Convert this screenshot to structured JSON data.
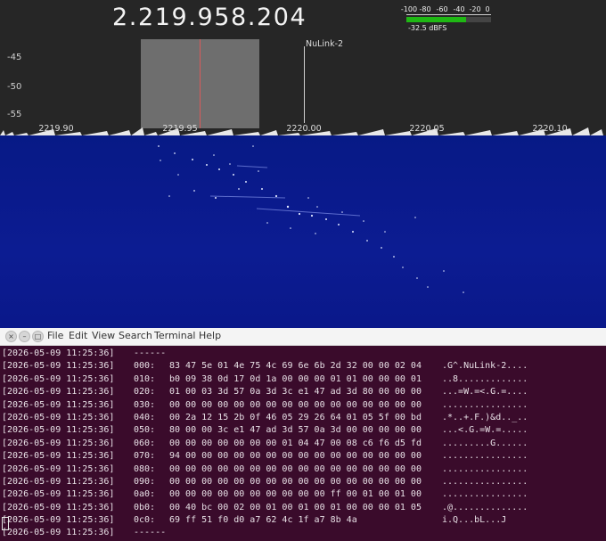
{
  "receiver": {
    "frequency": "2.219.958.204",
    "meter": {
      "scale": [
        "-100",
        "-80",
        "-60",
        "-40",
        "-20",
        "0"
      ],
      "readout": "-32.5 dBFS",
      "level_fraction": 0.71
    },
    "spectrum": {
      "y_labels": [
        "-45",
        "-50",
        "-55"
      ],
      "x_labels": [
        "2219.90",
        "2219.95",
        "2220.00",
        "2220.05",
        "2220.10"
      ],
      "marker_label": "NuLink-2"
    }
  },
  "terminal": {
    "window_buttons": [
      "×",
      "–",
      "□"
    ],
    "menu": [
      "File",
      "Edit",
      "View",
      "Search",
      "Terminal",
      "Help"
    ],
    "lines": [
      {
        "ts": "[2026-05-09 11:25:36]",
        "off": "------",
        "hex": "",
        "ascii": ""
      },
      {
        "ts": "[2026-05-09 11:25:36]",
        "off": "000:",
        "hex": "83 47 5e 01 4e 75 4c 69 6e 6b 2d 32 00 00 02 04",
        "ascii": ".G^.NuLink-2...."
      },
      {
        "ts": "[2026-05-09 11:25:36]",
        "off": "010:",
        "hex": "b0 09 38 0d 17 0d 1a 00 00 00 01 01 00 00 00 01",
        "ascii": "..8............."
      },
      {
        "ts": "[2026-05-09 11:25:36]",
        "off": "020:",
        "hex": "01 00 03 3d 57 0a 3d 3c e1 47 ad 3d 80 00 00 00",
        "ascii": "...=W.=<.G.=...."
      },
      {
        "ts": "[2026-05-09 11:25:36]",
        "off": "030:",
        "hex": "00 00 00 00 00 00 00 00 00 00 00 00 00 00 00 00",
        "ascii": "................"
      },
      {
        "ts": "[2026-05-09 11:25:36]",
        "off": "040:",
        "hex": "00 2a 12 15 2b 0f 46 05 29 26 64 01 05 5f 00 bd",
        "ascii": ".*..+.F.)&d.._.."
      },
      {
        "ts": "[2026-05-09 11:25:36]",
        "off": "050:",
        "hex": "80 00 00 3c e1 47 ad 3d 57 0a 3d 00 00 00 00 00",
        "ascii": "...<.G.=W.=....."
      },
      {
        "ts": "[2026-05-09 11:25:36]",
        "off": "060:",
        "hex": "00 00 00 00 00 00 00 01 04 47 00 08 c6 f6 d5 fd",
        "ascii": ".........G......"
      },
      {
        "ts": "[2026-05-09 11:25:36]",
        "off": "070:",
        "hex": "94 00 00 00 00 00 00 00 00 00 00 00 00 00 00 00",
        "ascii": "................"
      },
      {
        "ts": "[2026-05-09 11:25:36]",
        "off": "080:",
        "hex": "00 00 00 00 00 00 00 00 00 00 00 00 00 00 00 00",
        "ascii": "................"
      },
      {
        "ts": "[2026-05-09 11:25:36]",
        "off": "090:",
        "hex": "00 00 00 00 00 00 00 00 00 00 00 00 00 00 00 00",
        "ascii": "................"
      },
      {
        "ts": "[2026-05-09 11:25:36]",
        "off": "0a0:",
        "hex": "00 00 00 00 00 00 00 00 00 00 ff 00 01 00 01 00",
        "ascii": "................"
      },
      {
        "ts": "[2026-05-09 11:25:36]",
        "off": "0b0:",
        "hex": "00 40 bc 00 02 00 01 00 01 00 01 00 00 00 01 05",
        "ascii": ".@.............."
      },
      {
        "ts": "[2026-05-09 11:25:36]",
        "off": "0c0:",
        "hex": "69 ff 51 f0 d0 a7 62 4c 1f a7 8b 4a",
        "ascii": "i.Q...bL...J"
      },
      {
        "ts": "[2026-05-09 11:25:36]",
        "off": "------",
        "hex": "",
        "ascii": ""
      }
    ]
  }
}
